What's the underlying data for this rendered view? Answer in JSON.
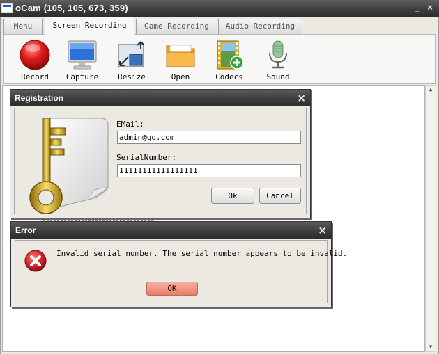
{
  "window": {
    "title": "oCam (105, 105, 673, 359)",
    "minimize_glyph": "_",
    "close_glyph": "×"
  },
  "tabs": [
    {
      "label": "Menu"
    },
    {
      "label": "Screen Recording"
    },
    {
      "label": "Game Recording"
    },
    {
      "label": "Audio Recording"
    }
  ],
  "active_tab": "Screen Recording",
  "toolbar": {
    "items": [
      {
        "label": "Record",
        "icon": "record-icon"
      },
      {
        "label": "Capture",
        "icon": "monitor-icon"
      },
      {
        "label": "Resize",
        "icon": "resize-icon"
      },
      {
        "label": "Open",
        "icon": "folder-icon"
      },
      {
        "label": "Codecs",
        "icon": "film-add-icon"
      },
      {
        "label": "Sound",
        "icon": "microphone-icon"
      }
    ]
  },
  "registration_dialog": {
    "title": "Registration",
    "close_glyph": "×",
    "email_label": "EMail:",
    "email_value": "admin@qq.com",
    "serial_label": "SerialNumber:",
    "serial_value": "11111111111111111",
    "ok_label": "Ok",
    "cancel_label": "Cancel"
  },
  "error_dialog": {
    "title": "Error",
    "close_glyph": "×",
    "message": "Invalid serial number. The serial number appears to be invalid.",
    "ok_label": "OK"
  },
  "colors": {
    "titlebar": "#3c3c3c",
    "record_red": "#e21c1c",
    "error_red": "#d8262a",
    "ok_button": "#e87d66"
  }
}
